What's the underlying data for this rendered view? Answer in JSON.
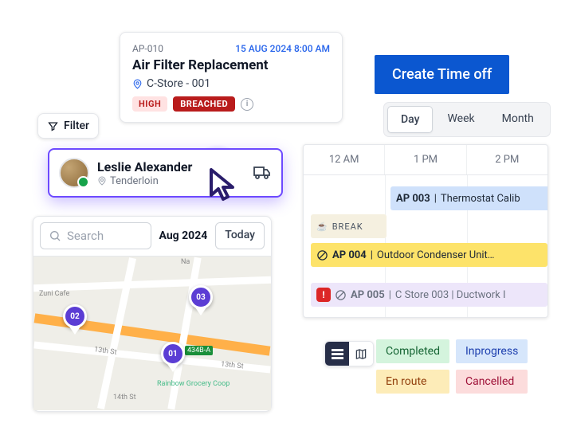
{
  "filter": {
    "label": "Filter"
  },
  "job": {
    "id": "AP-010",
    "datetime": "15 AUG 2024 8:00 AM",
    "title": "Air Filter Replacement",
    "location": "C-Store - 001",
    "priority": "HIGH",
    "sla": "BREACHED"
  },
  "technician": {
    "name": "Leslie Alexander",
    "location": "Tenderloin"
  },
  "map": {
    "search_placeholder": "Search",
    "month": "Aug 2024",
    "today": "Today",
    "pins": [
      {
        "label": "01"
      },
      {
        "label": "02"
      },
      {
        "label": "03"
      }
    ],
    "streets": [
      "Zuni Cafe",
      "Na",
      "13th St",
      "13th St",
      "14th St",
      "Rainbow Grocery Coop"
    ],
    "route": "434B-A"
  },
  "actions": {
    "create_time_off": "Create Time off"
  },
  "range": {
    "day": "Day",
    "week": "Week",
    "month": "Month"
  },
  "schedule": {
    "cols": [
      "12 AM",
      "1 PM",
      "2 PM"
    ],
    "break": "BREAK",
    "events": [
      {
        "code": "AP 003",
        "title": "Thermostat Calib"
      },
      {
        "code": "AP 004",
        "title": "Outdoor Condenser Unit…"
      },
      {
        "code": "AP 005",
        "title": "C Store 003 | Ductwork I"
      }
    ]
  },
  "view": {
    "list_active": true
  },
  "statuses": {
    "completed": "Completed",
    "inprogress": "Inprogress",
    "enroute": "En route",
    "cancelled": "Cancelled"
  }
}
